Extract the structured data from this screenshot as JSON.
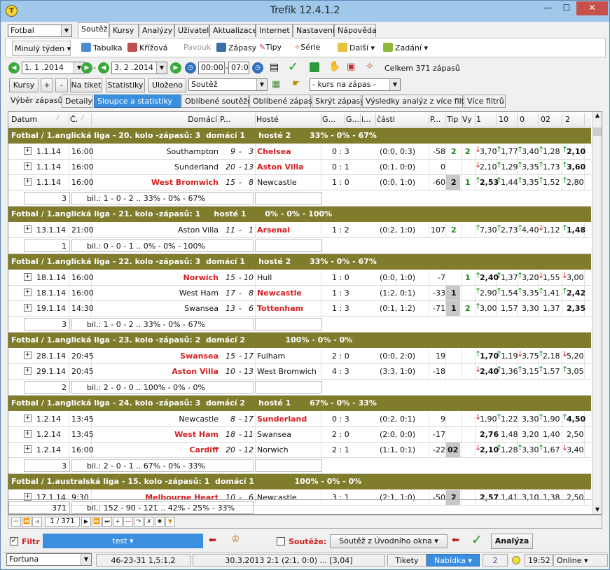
{
  "window": {
    "title": "Trefík 12.4.1.2",
    "minimize": "—",
    "maximize": "☐",
    "close": "✕"
  },
  "sport_select": "Fotbal",
  "menu_tabs": [
    "Soutěž",
    "Kursy",
    "Analýzy",
    "Uživatel",
    "Aktualizace",
    "Internet",
    "Nastavení",
    "Nápověda"
  ],
  "toolbar": {
    "period": "Minulý týden",
    "tabulka": "Tabulka",
    "krizova": "Křížová",
    "pavouk": "Pavouk",
    "zapasy": "Zápasy",
    "tipy": "Tipy",
    "serie": "Série",
    "dalsi": "Další",
    "zadani": "Zadání"
  },
  "datebar": {
    "date_from": "1. 1 .2014",
    "date_to": "3. 2 .2014",
    "time_from": "00:00",
    "time_to": "07:00",
    "total": "Celkem 371 zápasů"
  },
  "buttons": {
    "kursy": "Kursy",
    "plus": "+",
    "minus": "-",
    "na_tiket": "Na tiket",
    "statistiky": "Statistiky",
    "ulozeno": "Uloženo",
    "soutez_combo": "Soutěž",
    "kurs_combo": "- kurs na zápas -"
  },
  "view_tabs": [
    "Výběr zápasů",
    "Detaily",
    "Sloupce a statistiky",
    "Oblíbené soutěže",
    "Oblíbené zápasy",
    "Skrýt zápasy",
    "Výsledky analýz z více filtrů",
    "Více filtrů"
  ],
  "columns": [
    "Datum",
    "Č.",
    "Domácí",
    "P...",
    "Hosté",
    "G...",
    "G...",
    "i...",
    "části",
    "P...",
    "Tip",
    "Vy",
    "1",
    "10",
    "0",
    "02",
    "2"
  ],
  "groups": [
    {
      "header": "Fotbal / 1.anglická liga - 20. kolo -zápasů: 3  domácí 1     hosté 2       33% - 0% - 67%",
      "rows": [
        {
          "date": "1.1.14",
          "time": "16:00",
          "home": "Southampton",
          "home_win": false,
          "hp": "9",
          "ap": "3",
          "away": "Chelsea",
          "away_win": true,
          "score": "0 : 3",
          "halves": "(0:0, 0:3)",
          "p": "-58",
          "tip": "2",
          "vy": "2",
          "tip_gray": false,
          "o1": "3,70",
          "o10": "1,77",
          "o0": "3,40",
          "o02": "1,28",
          "o2": "2,10",
          "a1": "dn",
          "a10": "up",
          "a0": "up",
          "a02": "up",
          "a2": "up",
          "bold": "o2"
        },
        {
          "date": "1.1.14",
          "time": "16:00",
          "home": "Sunderland",
          "home_win": false,
          "hp": "20",
          "ap": "13",
          "away": "Aston Villa",
          "away_win": true,
          "score": "0 : 1",
          "halves": "(0:1, 0:0)",
          "p": "0",
          "tip": "",
          "vy": "",
          "tip_gray": false,
          "o1": "2,10",
          "o10": "1,29",
          "o0": "3,35",
          "o02": "1,73",
          "o2": "3,60",
          "a1": "dn",
          "a10": "up",
          "a0": "up",
          "a02": "up",
          "a2": "up",
          "bold": "o2"
        },
        {
          "date": "1.1.14",
          "time": "16:00",
          "home": "West Bromwich",
          "home_win": true,
          "hp": "15",
          "ap": "8",
          "away": "Newcastle",
          "away_win": false,
          "score": "1 : 0",
          "halves": "(0:0, 1:0)",
          "p": "-60",
          "tip": "2",
          "vy": "1",
          "tip_gray": true,
          "o1": "2,53",
          "o10": "1,44",
          "o0": "3,35",
          "o02": "1,52",
          "o2": "2,80",
          "a1": "up",
          "a10": "up",
          "a0": "up",
          "a02": "up",
          "a2": "up",
          "bold": "o1"
        }
      ],
      "summary_count": "3",
      "summary": "bil.: 1 - 0 - 2 .. 33% - 0% - 67%"
    },
    {
      "header": "Fotbal / 1.anglická liga - 21. kolo -zápasů: 1     hosté 1       0% - 0% - 100%",
      "rows": [
        {
          "date": "13.1.14",
          "time": "21:00",
          "home": "Aston Villa",
          "home_win": false,
          "hp": "11",
          "ap": "1",
          "away": "Arsenal",
          "away_win": true,
          "score": "1 : 2",
          "halves": "(0:2, 1:0)",
          "p": "107",
          "tip": "2",
          "vy": "",
          "tip_gray": false,
          "o1": "7,30",
          "o10": "2,73",
          "o0": "4,40",
          "o02": "1,12",
          "o2": "1,48",
          "a1": "up",
          "a10": "up",
          "a0": "up",
          "a02": "dn",
          "a2": "up",
          "bold": "o2"
        }
      ],
      "summary_count": "1",
      "summary": "bil.: 0 - 0 - 1 .. 0% - 0% - 100%"
    },
    {
      "header": "Fotbal / 1.anglická liga - 22. kolo -zápasů: 3  domácí 1     hosté 2       33% - 0% - 67%",
      "rows": [
        {
          "date": "18.1.14",
          "time": "16:00",
          "home": "Norwich",
          "home_win": true,
          "hp": "15",
          "ap": "10",
          "away": "Hull",
          "away_win": false,
          "score": "1 : 0",
          "halves": "(0:0, 1:0)",
          "p": "-7",
          "tip": "",
          "vy": "1",
          "tip_gray": false,
          "o1": "2,40",
          "o10": "1,37",
          "o0": "3,20",
          "o02": "1,55",
          "o2": "3,00",
          "a1": "up",
          "a10": "up",
          "a0": "up",
          "a02": "dn",
          "a2": "dn",
          "bold": "o1"
        },
        {
          "date": "18.1.14",
          "time": "16:00",
          "home": "West Ham",
          "home_win": false,
          "hp": "17",
          "ap": "8",
          "away": "Newcastle",
          "away_win": true,
          "score": "1 : 3",
          "halves": "(1:2, 0:1)",
          "p": "-33",
          "tip": "1",
          "vy": "",
          "tip_gray": true,
          "o1": "2,90",
          "o10": "1,54",
          "o0": "3,35",
          "o02": "1,41",
          "o2": "2,42",
          "a1": "up",
          "a10": "up",
          "a0": "up",
          "a02": "up",
          "a2": "up",
          "bold": "o2"
        },
        {
          "date": "19.1.14",
          "time": "14:30",
          "home": "Swansea",
          "home_win": false,
          "hp": "13",
          "ap": "6",
          "away": "Tottenham",
          "away_win": true,
          "score": "1 : 3",
          "halves": "(0:1, 1:2)",
          "p": "-71",
          "tip": "1",
          "vy": "2",
          "tip_gray": true,
          "o1": "3,00",
          "o10": "1,57",
          "o0": "3,30",
          "o02": "1,37",
          "o2": "2,35",
          "a1": "up",
          "a10": "",
          "a0": "",
          "a02": "",
          "a2": "",
          "bold": "o2"
        }
      ],
      "summary_count": "3",
      "summary": "bil.: 1 - 0 - 2 .. 33% - 0% - 67%"
    },
    {
      "header": "Fotbal / 1.anglická liga - 23. kolo -zápasů: 2  domácí 2               100% - 0% - 0%",
      "rows": [
        {
          "date": "28.1.14",
          "time": "20:45",
          "home": "Swansea",
          "home_win": true,
          "hp": "15",
          "ap": "17",
          "away": "Fulham",
          "away_win": false,
          "score": "2 : 0",
          "halves": "(0:0, 2:0)",
          "p": "19",
          "tip": "",
          "vy": "",
          "tip_gray": false,
          "o1": "1,70",
          "o10": "1,19",
          "o0": "3,75",
          "o02": "2,18",
          "o2": "5,20",
          "a1": "up",
          "a10": "up",
          "a0": "dn",
          "a02": "up",
          "a2": "dn",
          "bold": "o1"
        },
        {
          "date": "29.1.14",
          "time": "20:45",
          "home": "Aston Villa",
          "home_win": true,
          "hp": "10",
          "ap": "13",
          "away": "West Bromwich",
          "away_win": false,
          "score": "4 : 3",
          "halves": "(3:3, 1:0)",
          "p": "-18",
          "tip": "",
          "vy": "",
          "tip_gray": false,
          "o1": "2,40",
          "o10": "1,36",
          "o0": "3,15",
          "o02": "1,57",
          "o2": "3,05",
          "a1": "dn",
          "a10": "up",
          "a0": "up",
          "a02": "up",
          "a2": "up",
          "bold": "o1"
        }
      ],
      "summary_count": "2",
      "summary": "bil.: 2 - 0 - 0 .. 100% - 0% - 0%"
    },
    {
      "header": "Fotbal / 1.anglická liga - 24. kolo -zápasů: 3  domácí 2     hosté 1       67% - 0% - 33%",
      "rows": [
        {
          "date": "1.2.14",
          "time": "13:45",
          "home": "Newcastle",
          "home_win": false,
          "hp": "8",
          "ap": "17",
          "away": "Sunderland",
          "away_win": true,
          "score": "0 : 3",
          "halves": "(0:2, 0:1)",
          "p": "9",
          "tip": "",
          "vy": "",
          "tip_gray": false,
          "o1": "1,90",
          "o10": "1,22",
          "o0": "3,30",
          "o02": "1,90",
          "o2": "4,50",
          "a1": "dn",
          "a10": "up",
          "a0": "",
          "a02": "up",
          "a2": "up",
          "bold": "o2"
        },
        {
          "date": "1.2.14",
          "time": "13:45",
          "home": "West Ham",
          "home_win": true,
          "hp": "18",
          "ap": "11",
          "away": "Swansea",
          "away_win": false,
          "score": "2 : 0",
          "halves": "(2:0, 0:0)",
          "p": "-17",
          "tip": "",
          "vy": "",
          "tip_gray": false,
          "o1": "2,76",
          "o10": "1,48",
          "o0": "3,20",
          "o02": "1,40",
          "o2": "2,50",
          "a1": "",
          "a10": "",
          "a0": "",
          "a02": "",
          "a2": "",
          "bold": "o1"
        },
        {
          "date": "1.2.14",
          "time": "16:00",
          "home": "Cardiff",
          "home_win": true,
          "hp": "20",
          "ap": "12",
          "away": "Norwich",
          "away_win": false,
          "score": "2 : 1",
          "halves": "(1:1, 0:1)",
          "p": "-22",
          "tip": "02",
          "vy": "",
          "tip_gray": true,
          "o1": "2,10",
          "o10": "1,28",
          "o0": "3,30",
          "o02": "1,67",
          "o2": "3,40",
          "a1": "dn",
          "a10": "up",
          "a0": "up",
          "a02": "up",
          "a2": "dn",
          "bold": "o1"
        }
      ],
      "summary_count": "3",
      "summary": "bil.: 2 - 0 - 1 .. 67% - 0% - 33%"
    },
    {
      "header": "Fotbal / 1.australská liga - 15. kolo -zápasů: 1  domácí 1               100% - 0% - 0%",
      "rows": [
        {
          "date": "17.1.14",
          "time": "9:30",
          "home": "Melbourne Heart",
          "home_win": true,
          "hp": "10",
          "ap": "6",
          "away": "Newcastle",
          "away_win": false,
          "score": "3 : 1",
          "halves": "(2:1, 1:0)",
          "p": "-50",
          "tip": "2",
          "vy": "",
          "tip_gray": true,
          "o1": "2,57",
          "o10": "1,41",
          "o0": "3,10",
          "o02": "1,38",
          "o2": "2,50",
          "a1": "",
          "a10": "",
          "a0": "",
          "a02": "",
          "a2": "",
          "bold": "o1"
        }
      ],
      "summary_count": "",
      "summary": ""
    }
  ],
  "total_summary": {
    "count": "371",
    "text": "bil.: 152 - 90 - 121 .. 42% - 25% - 33%"
  },
  "nav": {
    "position": "1 / 371"
  },
  "filterbar": {
    "filtr": "Filtr",
    "filter_value": "test",
    "soutezi": "Soutěže:",
    "soutez_value": "Soutěž z Úvodního okna",
    "analyza": "Analýza"
  },
  "statusbar": {
    "bookmaker": "Fortuna",
    "record": "46-23-31  1,5:1,2",
    "last": "30.3.2013 2:1 (2:1, 0:0) ... [3,04]",
    "tikety": "Tikety",
    "nabidka": "Nabídka",
    "count": "2",
    "time": "19:52",
    "mode": "Online"
  },
  "colors": {
    "group_bg": "#7f7c2c",
    "winner": "#d42020",
    "accent": "#3b8fe0"
  }
}
